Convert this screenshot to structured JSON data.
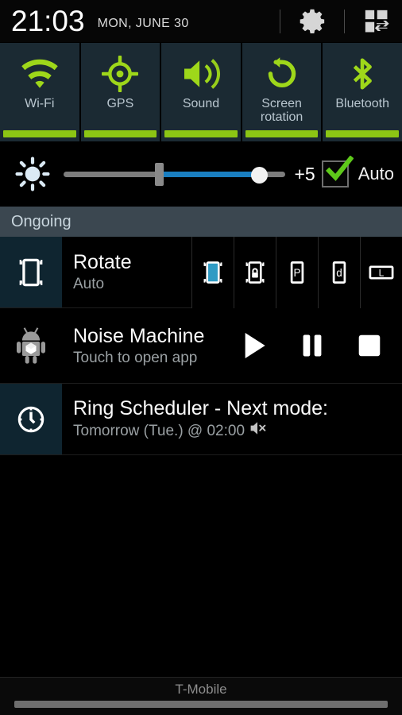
{
  "statusbar": {
    "time": "21:03",
    "date": "MON, JUNE 30",
    "settings_icon": "gear-icon",
    "toggles_arrange_icon": "quick-settings-grid-icon"
  },
  "quick_toggles": [
    {
      "label": "Wi-Fi",
      "icon": "wifi-icon",
      "active": true
    },
    {
      "label": "GPS",
      "icon": "gps-crosshair-icon",
      "active": true
    },
    {
      "label": "Sound",
      "icon": "speaker-volume-icon",
      "active": true
    },
    {
      "label": "Screen\nrotation",
      "label_line1": "Screen",
      "label_line2": "rotation",
      "icon": "rotate-arrow-icon",
      "active": true
    },
    {
      "label": "Bluetooth",
      "icon": "bluetooth-icon",
      "active": true
    }
  ],
  "brightness": {
    "icon": "brightness-sun-icon",
    "level_label": "+5",
    "auto_label": "Auto",
    "auto_checked": true,
    "tick_percent": 43,
    "thumb_percent": 88
  },
  "sections": {
    "ongoing": "Ongoing"
  },
  "notifications": [
    {
      "id": "rotate",
      "icon": "rotation-lock-icon",
      "title": "Rotate",
      "subtitle": "Auto",
      "actions": [
        {
          "name": "auto-rotate-button",
          "glyph": "auto-rotate-icon",
          "selected": true
        },
        {
          "name": "rotation-lock-button",
          "glyph": "rotate-lock-icon",
          "selected": false
        },
        {
          "name": "portrait-button",
          "glyph": "P",
          "selected": false
        },
        {
          "name": "reverse-portrait-button",
          "glyph": "d",
          "selected": false
        },
        {
          "name": "landscape-button",
          "glyph": "L",
          "selected": false
        }
      ]
    },
    {
      "id": "noise-machine",
      "icon": "android-robot-icon",
      "title": "Noise Machine",
      "subtitle": "Touch to open app",
      "actions": [
        {
          "name": "play-button",
          "glyph": "play-icon"
        },
        {
          "name": "pause-button",
          "glyph": "pause-icon"
        },
        {
          "name": "stop-button",
          "glyph": "stop-icon"
        }
      ]
    },
    {
      "id": "ring-scheduler",
      "icon": "clock-icon",
      "title": "Ring Scheduler - Next mode:",
      "subtitle": "Tomorrow (Tue.) @ 02:00",
      "subtitle_icon": "mute-speaker-icon"
    }
  ],
  "footer": {
    "carrier": "T-Mobile"
  },
  "colors": {
    "accent_green": "#8cc514",
    "toggle_bg": "#1b2a33",
    "icon_column_bg": "#0f2530",
    "section_bg": "#3b4750",
    "slider_fill": "#1a7fc1"
  }
}
